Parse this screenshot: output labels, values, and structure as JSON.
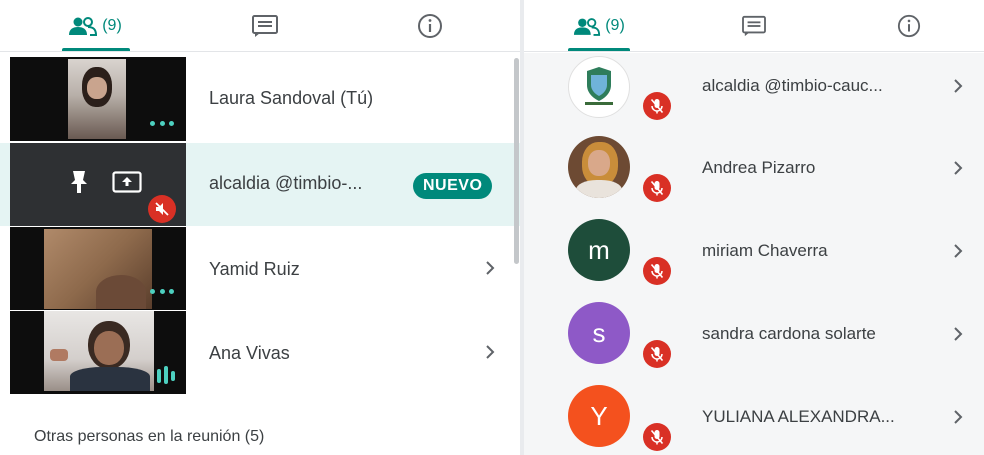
{
  "left": {
    "tabs": {
      "people_count": "(9)"
    },
    "participants": [
      {
        "name": "Laura Sandoval (Tú)"
      },
      {
        "name": "alcaldia @timbio-...",
        "badge": "NUEVO"
      },
      {
        "name": "Yamid Ruiz"
      },
      {
        "name": "Ana Vivas"
      }
    ],
    "section_label": "Otras personas en la reunión (5)"
  },
  "right": {
    "tabs": {
      "people_count": "(9)"
    },
    "participants": [
      {
        "name": "alcaldia @timbio-cauc...",
        "avatar": "logo"
      },
      {
        "name": "Andrea Pizarro",
        "avatar": "photo"
      },
      {
        "name": "miriam Chaverra",
        "avatar": "initial",
        "initial": "m",
        "color": "#1e4d3a"
      },
      {
        "name": "sandra cardona solarte",
        "avatar": "initial",
        "initial": "s",
        "color": "#8e59c7"
      },
      {
        "name": "YULIANA ALEXANDRA...",
        "avatar": "initial",
        "initial": "Y",
        "color": "#f4511e"
      }
    ]
  },
  "colors": {
    "accent": "#00897b",
    "mic_off": "#d93025",
    "highlight": "#e5f4f3"
  }
}
